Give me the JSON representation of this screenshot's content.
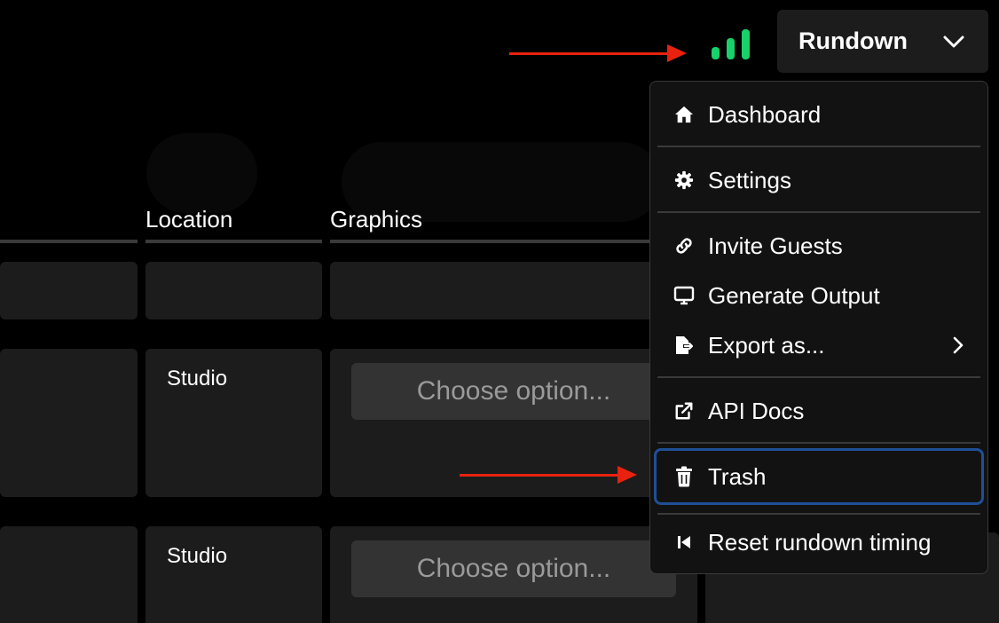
{
  "topbar": {
    "rundown_label": "Rundown",
    "status_color": "#19d16a"
  },
  "table": {
    "columns": [
      {
        "label": "Location"
      },
      {
        "label": "Graphics"
      }
    ],
    "rows": [
      {
        "location": "",
        "graphics": ""
      },
      {
        "location": "Studio",
        "graphics_placeholder": "Choose option..."
      },
      {
        "location": "Studio",
        "graphics_placeholder": "Choose option..."
      }
    ]
  },
  "menu": {
    "items": [
      {
        "label": "Dashboard",
        "icon": "home-icon"
      },
      {
        "label": "Settings",
        "icon": "gear-icon"
      },
      {
        "label": "Invite Guests",
        "icon": "link-icon"
      },
      {
        "label": "Generate Output",
        "icon": "monitor-icon"
      },
      {
        "label": "Export as...",
        "icon": "file-export-icon",
        "submenu": true
      },
      {
        "label": "API Docs",
        "icon": "external-link-icon"
      },
      {
        "label": "Trash",
        "icon": "trash-icon",
        "highlighted": true
      },
      {
        "label": "Reset rundown timing",
        "icon": "skip-back-icon"
      }
    ]
  },
  "colors": {
    "accent_highlight": "#1f4f96",
    "annotation_arrow": "#e8220f"
  }
}
